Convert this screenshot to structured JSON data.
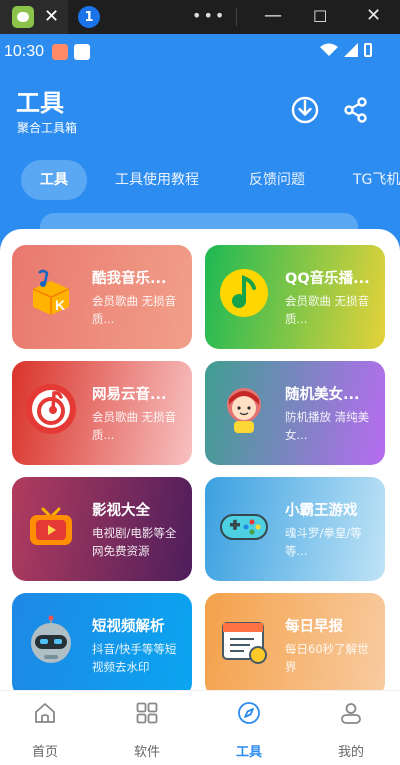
{
  "status": {
    "time": "10:30"
  },
  "header": {
    "title": "工具",
    "subtitle": "聚合工具箱"
  },
  "tabs": [
    {
      "label": "工具",
      "active": true
    },
    {
      "label": "工具使用教程"
    },
    {
      "label": "反馈问题"
    },
    {
      "label": "TG飞机"
    }
  ],
  "cards": [
    {
      "name": "酷我音乐...",
      "desc": "会员歌曲 无损音质...",
      "icon": "kuwo-music-icon"
    },
    {
      "name": "QQ音乐播...",
      "desc": "会员歌曲 无损音质...",
      "icon": "qq-music-icon"
    },
    {
      "name": "网易云音...",
      "desc": "会员歌曲 无损音质...",
      "icon": "netease-music-icon"
    },
    {
      "name": "随机美女...",
      "desc": "防机播放 清纯美女...",
      "icon": "girl-avatar-icon"
    },
    {
      "name": "影视大全",
      "desc": "电视剧/电影等全网免费资源",
      "icon": "tv-icon"
    },
    {
      "name": "小霸王游戏",
      "desc": "魂斗罗/拳皇/等等...",
      "icon": "gamepad-icon"
    },
    {
      "name": "短视频解析",
      "desc": "抖音/快手等等短视频去水印",
      "icon": "robot-icon"
    },
    {
      "name": "每日早报",
      "desc": "每日60秒了解世界",
      "icon": "calendar-icon"
    }
  ],
  "nav": [
    {
      "label": "首页",
      "icon": "home-icon"
    },
    {
      "label": "软件",
      "icon": "grid-icon"
    },
    {
      "label": "工具",
      "icon": "compass-icon",
      "active": true
    },
    {
      "label": "我的",
      "icon": "user-icon"
    }
  ],
  "colors": {
    "primary": "#2d8cf0"
  }
}
